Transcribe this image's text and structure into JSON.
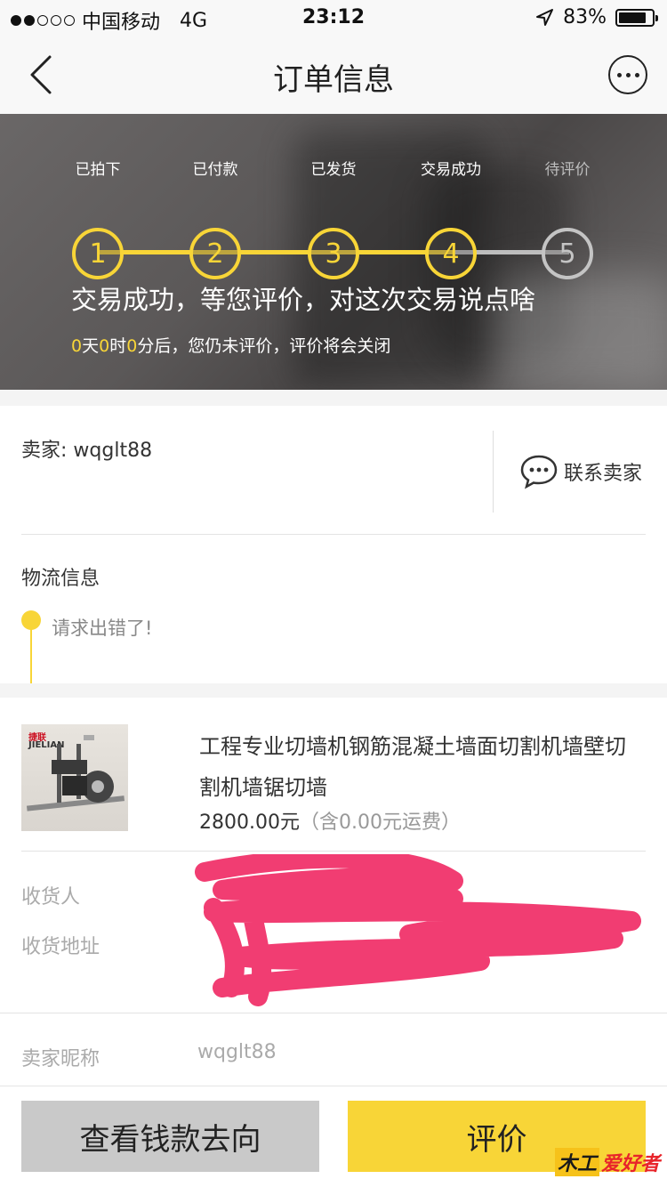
{
  "status_bar": {
    "carrier": "中国移动",
    "network": "4G",
    "time": "23:12",
    "battery": "83%",
    "battery_level": 0.83,
    "signal_bars_filled": 2,
    "signal_bars_total": 5
  },
  "nav": {
    "title": "订单信息",
    "back_icon": "chevron-left-icon",
    "more_icon": "more-circle-icon"
  },
  "progress": {
    "steps": [
      {
        "label": "已拍下",
        "number": "1",
        "done": true
      },
      {
        "label": "已付款",
        "number": "2",
        "done": true
      },
      {
        "label": "已发货",
        "number": "3",
        "done": true
      },
      {
        "label": "交易成功",
        "number": "4",
        "done": true
      },
      {
        "label": "待评价",
        "number": "5",
        "done": false
      }
    ],
    "headline": "交易成功，等您评价，对这次交易说点啥",
    "countdown": {
      "days": "0",
      "days_unit": "天",
      "hours": "0",
      "hours_unit": "时",
      "minutes": "0",
      "suffix": "分后，您仍未评价，评价将会关闭"
    }
  },
  "seller": {
    "label": "卖家: wqglt88",
    "contact_label": "联系卖家"
  },
  "logistics": {
    "title": "物流信息",
    "message": "请求出错了!"
  },
  "product": {
    "title": "工程专业切墙机钢筋混凝土墙面切割机墙壁切割机墙锯切墙",
    "price": "2800.00元",
    "shipping": "（含0.00元运费）",
    "thumb_brand": "捷联",
    "thumb_brand_en": "JIELIAN"
  },
  "order_info": {
    "receiver_label": "收货人",
    "address_label": "收货地址",
    "seller_nick_label": "卖家昵称",
    "seller_nick_value": "wqglt88"
  },
  "actions": {
    "money_flow": "查看钱款去向",
    "review": "评价"
  },
  "watermark": {
    "part1": "木工",
    "part2": "爱好者"
  },
  "colors": {
    "accent": "#f8d537",
    "grey_button": "#c9c9c9",
    "scribble": "#f0336a"
  }
}
